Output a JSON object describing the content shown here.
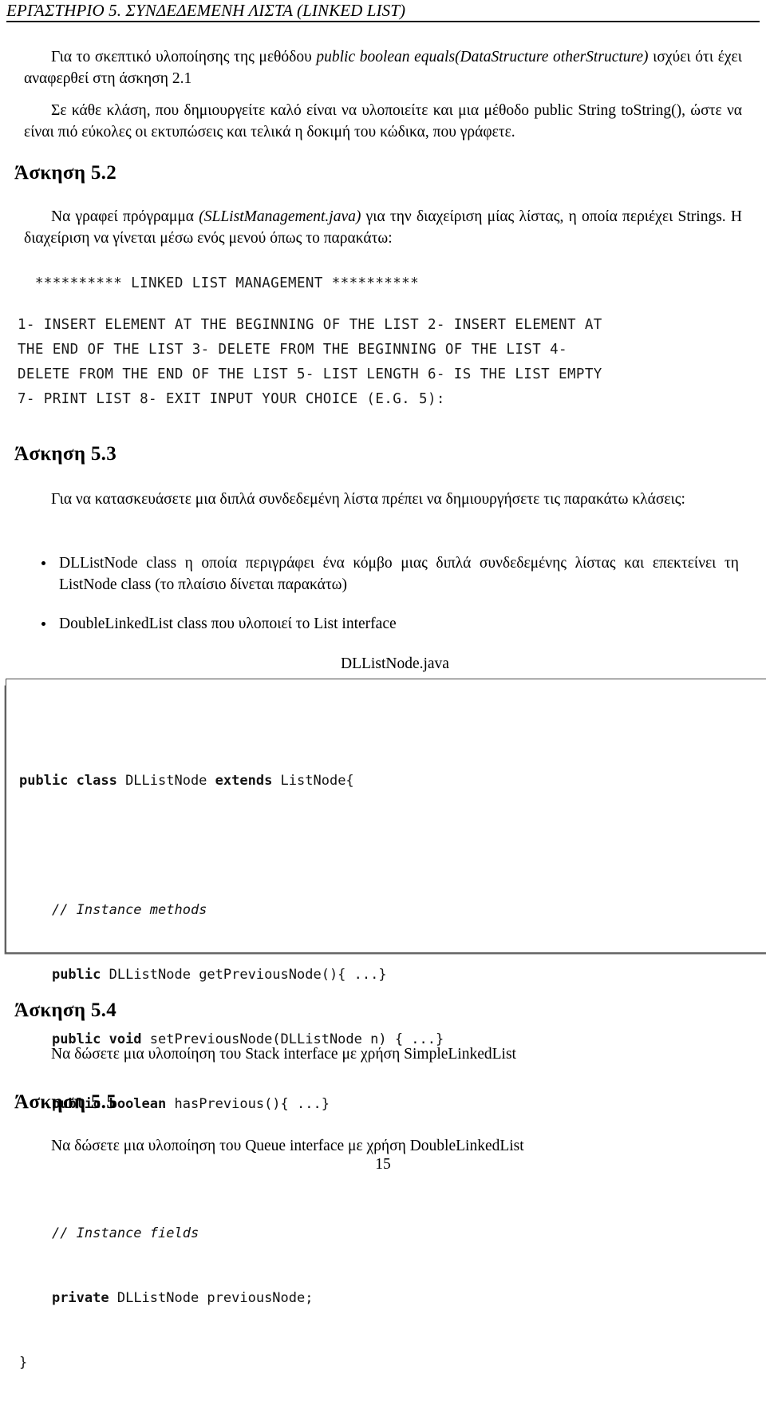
{
  "header": {
    "title": "ΕΡΓΑΣΤΗΡΙΟ 5.  ΣΥΝΔΕΔΕΜΕΝΗ ΛΙΣΤΑ (LINKED LIST)"
  },
  "intro": {
    "para1_a": "Για το σκεπτικό υλοποίησης της μεθόδου ",
    "para1_italic": "public boolean equals(DataStructure otherStructure)",
    "para1_b": " ισχύει ότι έχει αναφερθεί στη άσκηση 2.1",
    "para2": "Σε κάθε κλάση, που δημιουργείτε καλό είναι να υλοποιείτε και μια μέθοδο public String toString(), ώστε να είναι πιό εύκολες οι εκτυπώσεις και τελικά η δοκιμή του κώδικα, που γράφετε."
  },
  "exercise_52": {
    "heading": "Άσκηση 5.2",
    "body_a": "Να γραφεί πρόγραμμα ",
    "body_italic": "(SLListManagement.java)",
    "body_b": " για την διαχείριση μίας λίστας, η οποία περιέχει Strings. Η διαχείριση να γίνεται μέσω ενός μενού όπως το παρακάτω:",
    "menu_title": "  ********** LINKED LIST MANAGEMENT **********",
    "menu_body": "1- INSERT ELEMENT AT THE BEGINNING OF THE LIST 2- INSERT ELEMENT AT\nTHE END OF THE LIST 3- DELETE FROM THE BEGINNING OF THE LIST 4-\nDELETE FROM THE END OF THE LIST 5- LIST LENGTH 6- IS THE LIST EMPTY\n7- PRINT LIST 8- EXIT INPUT YOUR CHOICE (E.G. 5):"
  },
  "exercise_53": {
    "heading": "Άσκηση 5.3",
    "intro": "Για να κατασκευάσετε μια διπλά συνδεδεμένη λίστα πρέπει να δημιουργήσετε τις παρακάτω κλάσεις:",
    "bullets": [
      "DLListNode class η οποία περιγράφει ένα κόμβο μιας διπλά συνδεδεμένης λίστας και επεκτείνει τη ListNode class (το πλαίσιο δίνεται παρακάτω)",
      "DoubleLinkedList class που υλοποιεί το List interface"
    ],
    "code_caption": "DLListNode.java",
    "code": {
      "line1_kw1": "public class",
      "line1_rest": " DLListNode ",
      "line1_kw2": "extends",
      "line1_tail": " ListNode{",
      "comment1": "// Instance methods",
      "line2_kw": "public",
      "line2_rest": " DLListNode getPreviousNode(){ ...}",
      "line3_kw": "public void",
      "line3_rest": " setPreviousNode(DLListNode n) { ...}",
      "line4_kw": "public boolean",
      "line4_rest": " hasPrevious(){ ...}",
      "comment2": "// Instance fields",
      "line5_kw": "private",
      "line5_rest": " DLListNode previousNode;",
      "closing": "}"
    }
  },
  "exercise_54": {
    "heading": "Άσκηση 5.4",
    "body": "Να δώσετε μια υλοποίηση του Stack interface με χρήση SimpleLinkedList"
  },
  "exercise_55": {
    "heading": "Άσκηση 5.5",
    "body": "Να δώσετε μια υλοποίηση του Queue interface με χρήση DoubleLinkedList"
  },
  "footer": {
    "page_number": "15"
  }
}
